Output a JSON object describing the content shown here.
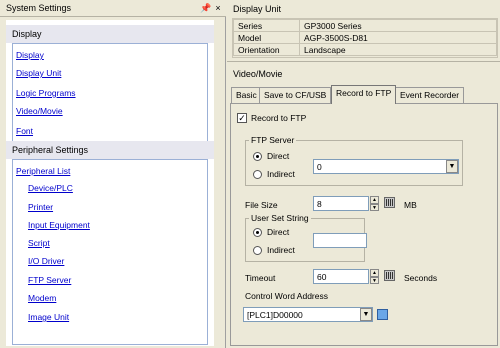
{
  "left_panel": {
    "title": "System Settings",
    "pin_glyph": "q",
    "close_glyph": "×",
    "sections": [
      {
        "header": "Display",
        "items": [
          "Display",
          "Display Unit",
          "Logic Programs",
          "Video/Movie",
          "Font"
        ]
      },
      {
        "header": "Peripheral Settings",
        "items": [
          "Peripheral List",
          "Device/PLC",
          "Printer",
          "Input Equipment",
          "Script",
          "I/O Driver",
          "FTP Server",
          "Modem",
          "Image Unit"
        ]
      }
    ]
  },
  "display_unit": {
    "title": "Display Unit",
    "rows": [
      {
        "label": "Series",
        "value": "GP3000 Series"
      },
      {
        "label": "Model",
        "value": "AGP-3500S-D81"
      },
      {
        "label": "Orientation",
        "value": "Landscape"
      }
    ]
  },
  "video_movie": {
    "title": "Video/Movie",
    "tabs": [
      "Basic",
      "Save to CF/USB",
      "Record to FTP",
      "Event Recorder"
    ],
    "active_tab": "Record to FTP",
    "record_to_ftp": {
      "checkbox_label": "Record  to FTP",
      "checked": true,
      "ftp_server": {
        "group_label": "FTP Server",
        "direct_label": "Direct",
        "indirect_label": "Indirect",
        "selected": "Direct",
        "value": "0"
      },
      "file_size": {
        "label": "File Size",
        "value": "8",
        "unit": "MB"
      },
      "user_set_string": {
        "group_label": "User Set String",
        "direct_label": "Direct",
        "indirect_label": "Indirect",
        "selected": "Direct",
        "value": ""
      },
      "timeout": {
        "label": "Timeout",
        "value": "60",
        "unit": "Seconds"
      },
      "control_word": {
        "label": "Control Word Address",
        "value": "[PLC1]D00000"
      }
    }
  }
}
